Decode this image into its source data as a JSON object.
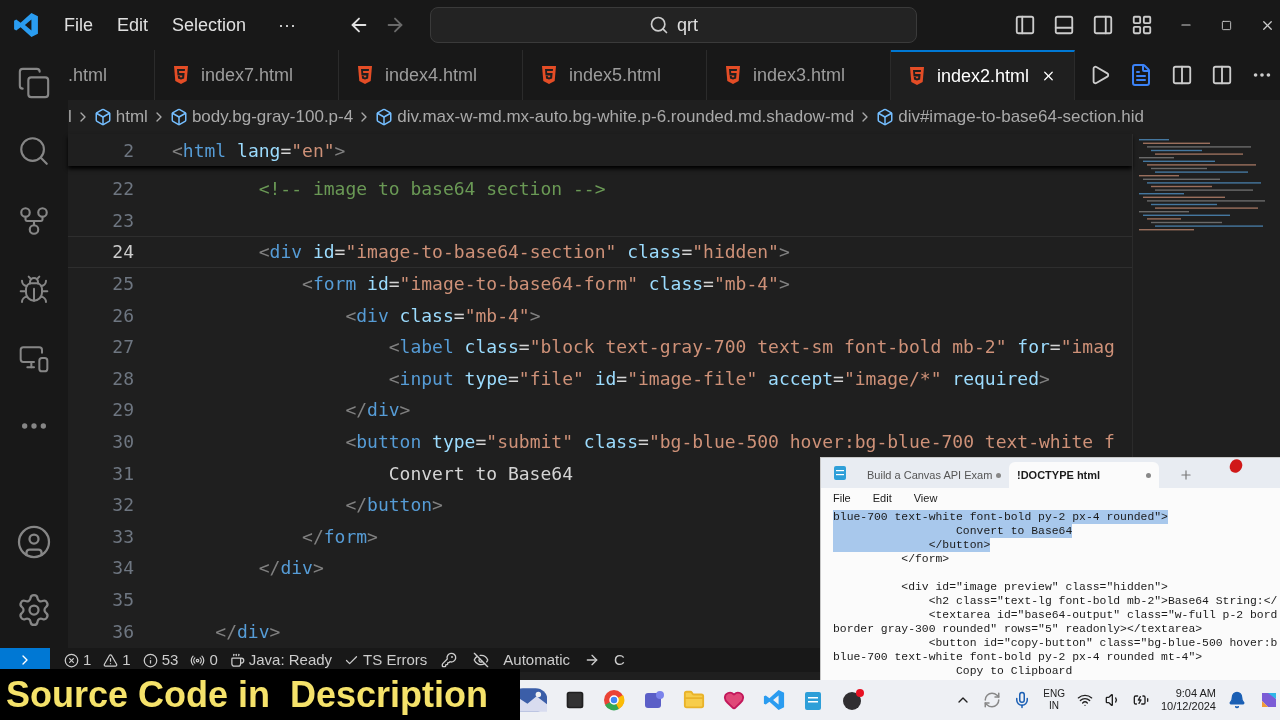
{
  "title_bar": {
    "menus": [
      "File",
      "Edit",
      "Selection"
    ],
    "more": "···",
    "search": "qrt"
  },
  "tabs": [
    {
      "label": ".html",
      "selected": false,
      "icon": false
    },
    {
      "label": "index7.html",
      "selected": false,
      "icon": true
    },
    {
      "label": "index4.html",
      "selected": false,
      "icon": true
    },
    {
      "label": "index5.html",
      "selected": false,
      "icon": true
    },
    {
      "label": "index3.html",
      "selected": false,
      "icon": true
    },
    {
      "label": "index2.html",
      "selected": true,
      "icon": true
    }
  ],
  "breadcrumb": [
    {
      "label": "l",
      "icon": false
    },
    {
      "label": "html",
      "icon": true
    },
    {
      "label": "body.bg-gray-100.p-4",
      "icon": true
    },
    {
      "label": "div.max-w-md.mx-auto.bg-white.p-6.rounded.md.shadow-md",
      "icon": true
    },
    {
      "label": "div#image-to-base64-section.hid",
      "icon": true
    }
  ],
  "editor": {
    "sticky": {
      "number": "2",
      "tokens": [
        {
          "kind": "punct",
          "text": "<"
        },
        {
          "kind": "tag",
          "text": "html"
        },
        {
          "kind": "attr",
          "text": " lang"
        },
        {
          "kind": "plain",
          "text": "="
        },
        {
          "kind": "string",
          "text": "\"en\""
        },
        {
          "kind": "punct",
          "text": ">"
        }
      ]
    },
    "lines": [
      {
        "number": "22",
        "current": false,
        "tokens": [
          {
            "kind": "comment",
            "text": "        <!-- image to base64 section -->"
          }
        ]
      },
      {
        "number": "23",
        "current": false
      },
      {
        "number": "24",
        "current": true,
        "tokens": [
          {
            "kind": "punct",
            "text": "        <"
          },
          {
            "kind": "tag",
            "text": "div"
          },
          {
            "kind": "attr",
            "text": " id"
          },
          {
            "kind": "plain",
            "text": "="
          },
          {
            "kind": "string",
            "text": "\"image-to-base64-section\""
          },
          {
            "kind": "attr",
            "text": " class"
          },
          {
            "kind": "plain",
            "text": "="
          },
          {
            "kind": "string",
            "text": "\"hidden\""
          },
          {
            "kind": "punct",
            "text": ">"
          }
        ]
      },
      {
        "number": "25",
        "current": false,
        "tokens": [
          {
            "kind": "punct",
            "text": "            <"
          },
          {
            "kind": "tag",
            "text": "form"
          },
          {
            "kind": "attr",
            "text": " id"
          },
          {
            "kind": "plain",
            "text": "="
          },
          {
            "kind": "string",
            "text": "\"image-to-base64-form\""
          },
          {
            "kind": "attr",
            "text": " class"
          },
          {
            "kind": "plain",
            "text": "="
          },
          {
            "kind": "string",
            "text": "\"mb-4\""
          },
          {
            "kind": "punct",
            "text": ">"
          }
        ]
      },
      {
        "number": "26",
        "current": false,
        "tokens": [
          {
            "kind": "punct",
            "text": "                <"
          },
          {
            "kind": "tag",
            "text": "div"
          },
          {
            "kind": "attr",
            "text": " class"
          },
          {
            "kind": "plain",
            "text": "="
          },
          {
            "kind": "string",
            "text": "\"mb-4\""
          },
          {
            "kind": "punct",
            "text": ">"
          }
        ]
      },
      {
        "number": "27",
        "current": false,
        "tokens": [
          {
            "kind": "punct",
            "text": "                    <"
          },
          {
            "kind": "tag",
            "text": "label"
          },
          {
            "kind": "attr",
            "text": " class"
          },
          {
            "kind": "plain",
            "text": "="
          },
          {
            "kind": "string",
            "text": "\"block text-gray-700 text-sm font-bold mb-2\""
          },
          {
            "kind": "attr",
            "text": " for"
          },
          {
            "kind": "plain",
            "text": "="
          },
          {
            "kind": "string",
            "text": "\"imag"
          }
        ]
      },
      {
        "number": "28",
        "current": false,
        "tokens": [
          {
            "kind": "punct",
            "text": "                    <"
          },
          {
            "kind": "tag",
            "text": "input"
          },
          {
            "kind": "attr",
            "text": " type"
          },
          {
            "kind": "plain",
            "text": "="
          },
          {
            "kind": "string",
            "text": "\"file\""
          },
          {
            "kind": "attr",
            "text": " id"
          },
          {
            "kind": "plain",
            "text": "="
          },
          {
            "kind": "string",
            "text": "\"image-file\""
          },
          {
            "kind": "attr",
            "text": " accept"
          },
          {
            "kind": "plain",
            "text": "="
          },
          {
            "kind": "string",
            "text": "\"image/*\""
          },
          {
            "kind": "attr",
            "text": " required"
          },
          {
            "kind": "punct",
            "text": ">"
          }
        ]
      },
      {
        "number": "29",
        "current": false,
        "tokens": [
          {
            "kind": "punct",
            "text": "                </"
          },
          {
            "kind": "tag",
            "text": "div"
          },
          {
            "kind": "punct",
            "text": ">"
          }
        ]
      },
      {
        "number": "30",
        "current": false,
        "tokens": [
          {
            "kind": "punct",
            "text": "                <"
          },
          {
            "kind": "tag",
            "text": "button"
          },
          {
            "kind": "attr",
            "text": " type"
          },
          {
            "kind": "plain",
            "text": "="
          },
          {
            "kind": "string",
            "text": "\"submit\""
          },
          {
            "kind": "attr",
            "text": " class"
          },
          {
            "kind": "plain",
            "text": "="
          },
          {
            "kind": "string",
            "text": "\"bg-blue-500 hover:bg-blue-700 text-white f"
          }
        ]
      },
      {
        "number": "31",
        "current": false,
        "tokens": [
          {
            "kind": "plain",
            "text": "                    Convert to Base64"
          }
        ]
      },
      {
        "number": "32",
        "current": false,
        "tokens": [
          {
            "kind": "punct",
            "text": "                </"
          },
          {
            "kind": "tag",
            "text": "button"
          },
          {
            "kind": "punct",
            "text": ">"
          }
        ]
      },
      {
        "number": "33",
        "current": false,
        "tokens": [
          {
            "kind": "punct",
            "text": "            </"
          },
          {
            "kind": "tag",
            "text": "form"
          },
          {
            "kind": "punct",
            "text": ">"
          }
        ]
      },
      {
        "number": "34",
        "current": false,
        "tokens": [
          {
            "kind": "punct",
            "text": "        </"
          },
          {
            "kind": "tag",
            "text": "div"
          },
          {
            "kind": "punct",
            "text": ">"
          }
        ]
      },
      {
        "number": "35",
        "current": false
      },
      {
        "number": "36",
        "current": false,
        "tokens": [
          {
            "kind": "punct",
            "text": "    </"
          },
          {
            "kind": "tag",
            "text": "div"
          },
          {
            "kind": "punct",
            "text": ">"
          }
        ]
      }
    ]
  },
  "status_bar": [
    {
      "kind": "errors",
      "text": "1"
    },
    {
      "kind": "warnings",
      "text": "1"
    },
    {
      "kind": "info",
      "text": "53"
    },
    {
      "kind": "ports",
      "text": "0"
    },
    {
      "kind": "java",
      "text": "Java: Ready"
    },
    {
      "kind": "check",
      "text": "TS Errors"
    },
    {
      "kind": "key"
    },
    {
      "kind": "copilot"
    },
    {
      "kind": "plain",
      "text": "Automatic"
    },
    {
      "kind": "arrow"
    },
    {
      "kind": "plain",
      "text": "C"
    }
  ],
  "banner": "Source Code in  Description",
  "notepad": {
    "tabs": [
      {
        "label": "Build a Canvas API Exam",
        "selected": false
      },
      {
        "label": "!DOCTYPE html",
        "selected": true
      }
    ],
    "menus": [
      "File",
      "Edit",
      "View"
    ],
    "lines": [
      {
        "text": "blue-700 text-white font-bold py-2 px-4 rounded\">",
        "selected": true
      },
      {
        "text": "                  Convert to Base64",
        "selected": true
      },
      {
        "text": "              </button>",
        "selected": true
      },
      {
        "text": "          </form>",
        "selected": false
      },
      {
        "text": "          <div id=\"image preview\" class=\"hidden\">",
        "selected": false
      },
      {
        "text": "              <h2 class=\"text-lg font-bold mb-2\">Base64 String:</",
        "selected": false
      },
      {
        "text": "              <textarea id=\"base64-output\" class=\"w-full p-2 bord",
        "selected": false
      },
      {
        "text": "border gray-300 rounded\" rows=\"5\" readonly></textarea>",
        "selected": false
      },
      {
        "text": "              <button id=\"copy-button\" class=\"bg-blue-500 hover:b",
        "selected": false
      },
      {
        "text": "blue-700 text-white font-bold py-2 px-4 rounded mt-4\">",
        "selected": false
      },
      {
        "text": "                  Copy to Clipboard",
        "selected": false
      }
    ]
  },
  "taskbar": {
    "language": "ENG",
    "region": "IN",
    "time": "9:04 AM",
    "date": "10/12/2024"
  }
}
